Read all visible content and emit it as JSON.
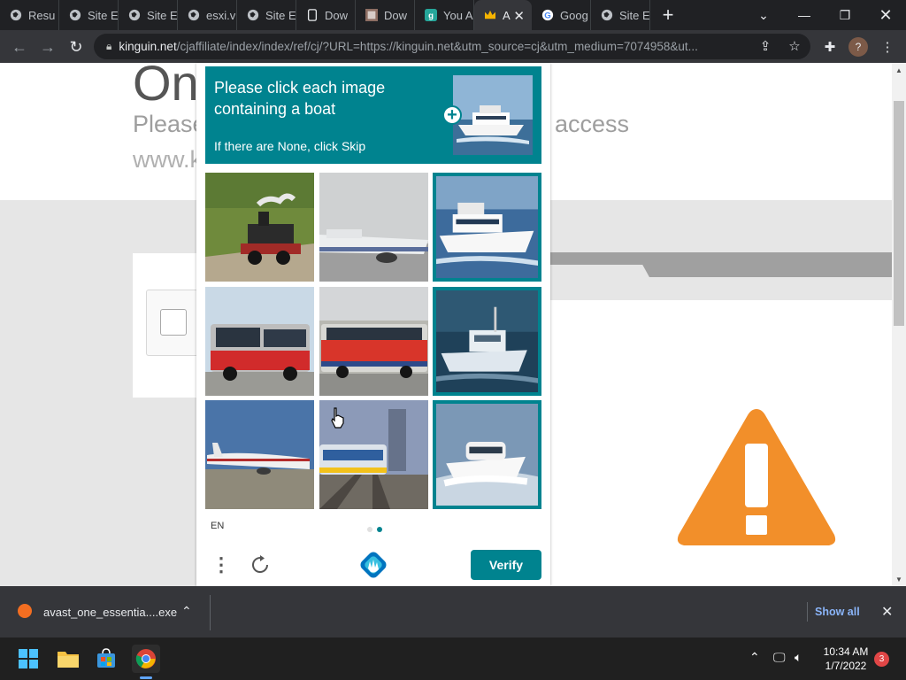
{
  "browser": {
    "tabs": [
      {
        "label": "Resu",
        "icon": "globe-icon"
      },
      {
        "label": "Site E",
        "icon": "globe-icon"
      },
      {
        "label": "Site E",
        "icon": "globe-icon"
      },
      {
        "label": "esxi.v",
        "icon": "globe-icon"
      },
      {
        "label": "Site E",
        "icon": "globe-icon"
      },
      {
        "label": "Dow",
        "icon": "phone-icon"
      },
      {
        "label": "Dow",
        "icon": "image-icon"
      },
      {
        "label": "You A",
        "icon": "g-icon"
      },
      {
        "label": "A",
        "icon": "crown-icon",
        "active": true
      },
      {
        "label": "Goog",
        "icon": "google-icon"
      },
      {
        "label": "Site E",
        "icon": "globe-icon"
      }
    ],
    "url_host": "kinguin.net",
    "url_path": "/cjaffiliate/index/index/ref/cj/?URL=https://kinguin.net&utm_source=cj&utm_medium=7074958&ut..."
  },
  "page": {
    "heading": "On",
    "please": "Please",
    "access": "access",
    "www": "www.k"
  },
  "captcha": {
    "prompt": "Please click each image containing a boat",
    "subprompt": "If there are None, click Skip",
    "language": "EN",
    "verify_label": "Verify",
    "accent": "#00838f",
    "tiles": [
      {
        "subject": "steam train",
        "selected": false
      },
      {
        "subject": "airplane",
        "selected": false
      },
      {
        "subject": "boat",
        "selected": true
      },
      {
        "subject": "bus",
        "selected": false
      },
      {
        "subject": "bus",
        "selected": false
      },
      {
        "subject": "boat",
        "selected": true
      },
      {
        "subject": "airplane",
        "selected": false
      },
      {
        "subject": "train",
        "selected": false
      },
      {
        "subject": "boat",
        "selected": true
      }
    ]
  },
  "downloads": {
    "file_name": "avast_one_essentia....exe",
    "show_all": "Show all"
  },
  "taskbar": {
    "time": "10:34 AM",
    "date": "1/7/2022",
    "notifications": "3"
  }
}
